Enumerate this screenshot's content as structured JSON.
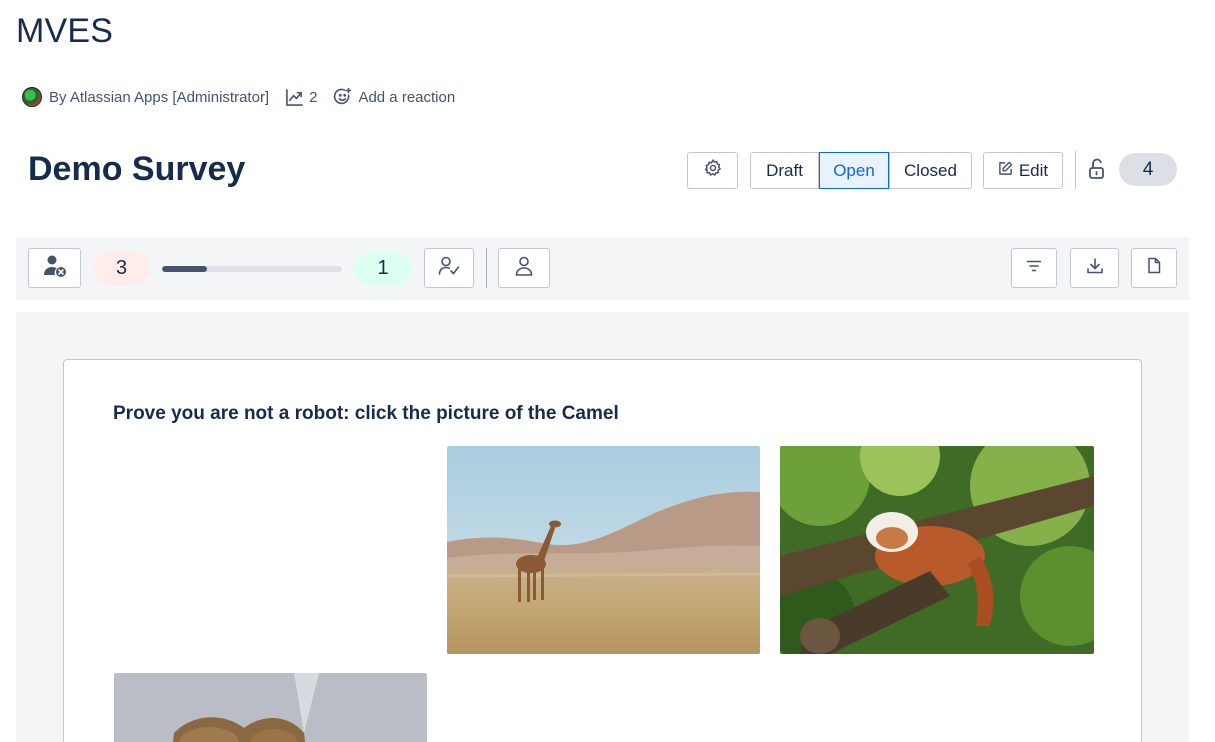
{
  "page": {
    "title": "MVES"
  },
  "byline": {
    "author": "By Atlassian Apps [Administrator]",
    "views": "2",
    "reaction_label": "Add a reaction",
    "icons": {
      "avatar": "user-avatar",
      "views": "chart-trend-icon",
      "reaction": "emoji-add-icon"
    }
  },
  "survey": {
    "title": "Demo Survey",
    "status_options": [
      "Draft",
      "Open",
      "Closed"
    ],
    "selected_status": "Open",
    "edit_label": "Edit",
    "count": "4",
    "icons": {
      "settings": "gear-icon",
      "edit": "edit-icon",
      "lock": "unlock-icon"
    }
  },
  "toolbar": {
    "declined_count": "3",
    "accepted_count": "1",
    "progress": 0.25,
    "icons": {
      "remove_user": "user-remove-icon",
      "user_check": "user-check-icon",
      "user": "user-icon",
      "filter": "filter-icon",
      "download": "download-icon",
      "document": "document-icon"
    }
  },
  "question": {
    "text": "Prove you are not a robot: click the picture of the Camel",
    "images": [
      "giraffe",
      "red-panda",
      "camel"
    ]
  },
  "colors": {
    "accent": "#0c66e4",
    "accent_bg": "#e9f2ff",
    "text": "#172b4d",
    "red_pill": "#ffeceb",
    "green_pill": "#dcfff1",
    "gray_pill": "#dcdfe4"
  }
}
